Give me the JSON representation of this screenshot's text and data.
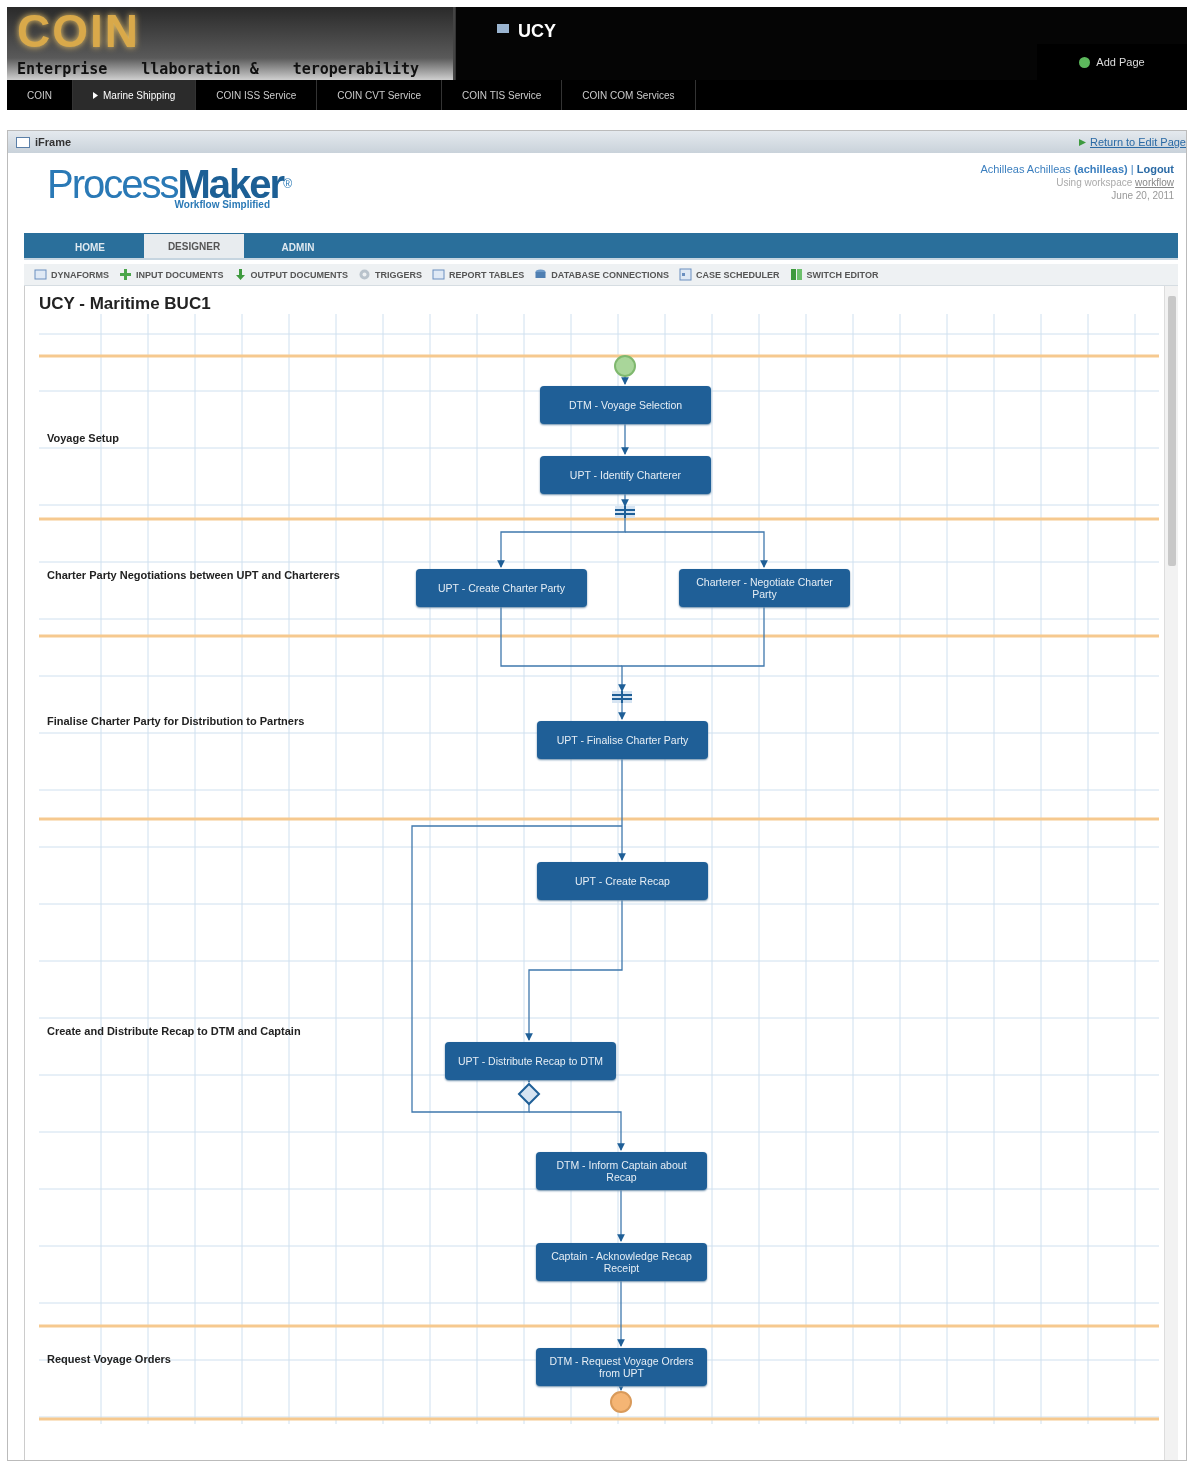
{
  "header": {
    "logo": "COIN",
    "tagline": [
      "Enterprise",
      "llaboration &",
      "teroperability"
    ],
    "site_title": "UCY",
    "add_page": "Add Page"
  },
  "nav": [
    {
      "label": "COIN",
      "selected": false
    },
    {
      "label": "Marine Shipping",
      "selected": true
    },
    {
      "label": "COIN ISS Service",
      "selected": false
    },
    {
      "label": "COIN CVT Service",
      "selected": false
    },
    {
      "label": "COIN TIS Service",
      "selected": false
    },
    {
      "label": "COIN COM Services",
      "selected": false
    }
  ],
  "frame": {
    "title": "iFrame",
    "return_link": "Return to Edit Page"
  },
  "app": {
    "logo": {
      "light": "Process",
      "bold": "Maker",
      "mark": "®",
      "tagline": "Workflow Simplified"
    },
    "user": {
      "name": "Achilleas Achilleas",
      "login": "(achilleas)",
      "separator": "|",
      "logout": "Logout",
      "workspace_label": "Using workspace",
      "workspace": "workflow",
      "date": "June 20, 2011"
    },
    "tabs": [
      {
        "label": "HOME",
        "selected": false
      },
      {
        "label": "DESIGNER",
        "selected": true
      },
      {
        "label": "ADMIN",
        "selected": false
      }
    ],
    "toolbar": [
      {
        "label": "DYNAFORMS",
        "kind": "form"
      },
      {
        "label": "INPUT DOCUMENTS",
        "kind": "upload"
      },
      {
        "label": "OUTPUT DOCUMENTS",
        "kind": "download"
      },
      {
        "label": "TRIGGERS",
        "kind": "gear"
      },
      {
        "label": "REPORT TABLES",
        "kind": "form"
      },
      {
        "label": "DATABASE CONNECTIONS",
        "kind": "database"
      },
      {
        "label": "CASE SCHEDULER",
        "kind": "calendar"
      },
      {
        "label": "SWITCH EDITOR",
        "kind": "switch"
      }
    ]
  },
  "process": {
    "title": "UCY - Maritime BUC1",
    "lanes": [
      {
        "label": "Voyage Setup"
      },
      {
        "label": "Charter Party Negotiations between UPT and Charterers"
      },
      {
        "label": "Finalise Charter Party for Distribution to Partners"
      },
      {
        "label": "Create and Distribute Recap to DTM and Captain"
      },
      {
        "label": "Request Voyage Orders"
      }
    ],
    "tasks": [
      {
        "label": "DTM - Voyage Selection"
      },
      {
        "label": "UPT - Identify Charterer"
      },
      {
        "label": "UPT - Create Charter Party"
      },
      {
        "label": "Charterer - Negotiate Charter Party"
      },
      {
        "label": "UPT - Finalise Charter Party"
      },
      {
        "label": "UPT - Create Recap"
      },
      {
        "label": "UPT - Distribute Recap to DTM"
      },
      {
        "label": "DTM - Inform Captain about Recap"
      },
      {
        "label": "Captain - Acknowledge Recap Receipt"
      },
      {
        "label": "DTM - Request Voyage Orders from UPT"
      }
    ]
  }
}
